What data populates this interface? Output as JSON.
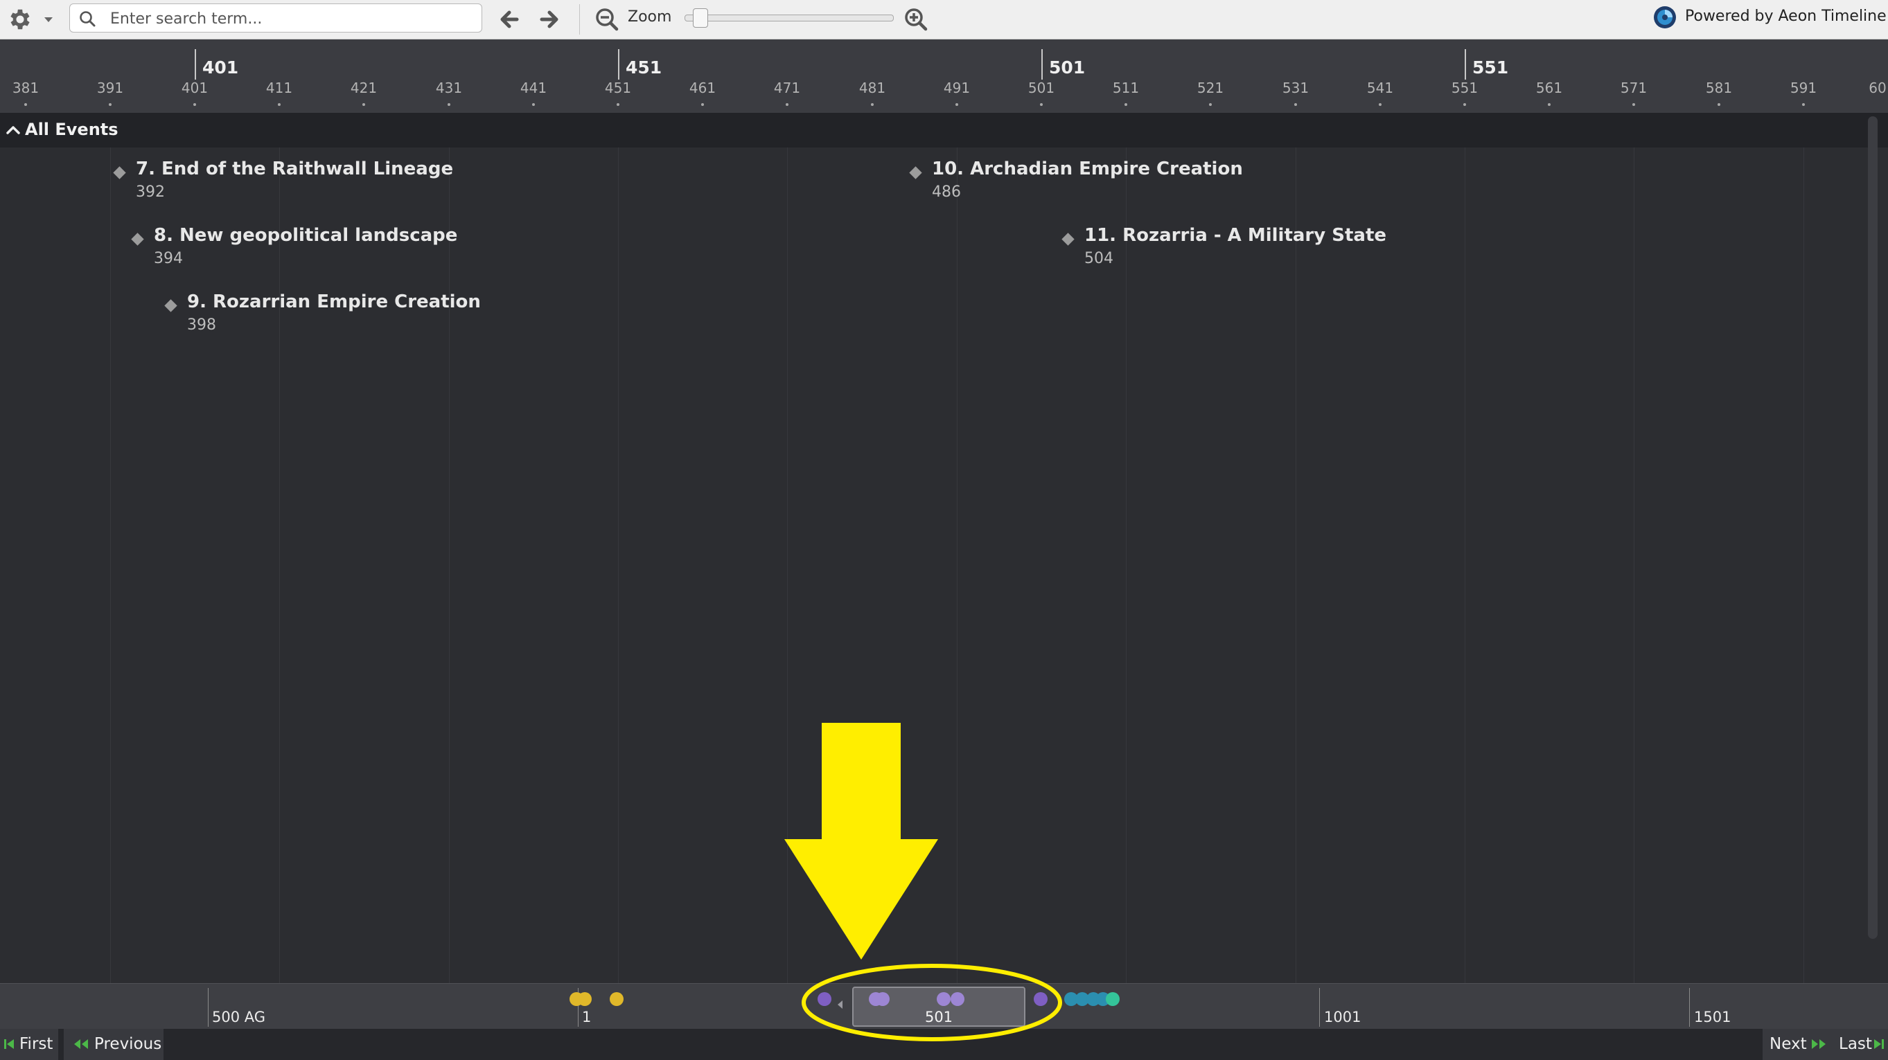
{
  "toolbar": {
    "settings_icon": "gear-icon",
    "search": {
      "placeholder": "Enter search term...",
      "value": ""
    },
    "back_icon": "arrow-left-icon",
    "forward_icon": "arrow-right-icon",
    "zoom_label": "Zoom",
    "zoom_level": 0.04,
    "powered_by": "Powered by Aeon Timeline"
  },
  "ruler": {
    "major_labels": [
      "401",
      "451",
      "501",
      "551"
    ],
    "minor_labels": [
      "381",
      "391",
      "401",
      "411",
      "421",
      "431",
      "441",
      "451",
      "461",
      "471",
      "481",
      "491",
      "501",
      "511",
      "521",
      "531",
      "541",
      "551",
      "561",
      "571",
      "581",
      "591",
      "60"
    ]
  },
  "group": {
    "label": "All Events"
  },
  "events": [
    {
      "title": "7. End of the Raithwall Lineage",
      "year": "392"
    },
    {
      "title": "8. New geopolitical landscape",
      "year": "394"
    },
    {
      "title": "9. Rozarrian Empire Creation",
      "year": "398"
    },
    {
      "title": "10. Archadian Empire Creation",
      "year": "486"
    },
    {
      "title": "11. Rozarria - A Military State",
      "year": "504"
    }
  ],
  "overview": {
    "labels": [
      "500 AG",
      "1",
      "501",
      "1001",
      "1501"
    ],
    "viewport_label": "501",
    "dot_colors": {
      "gold": "#e0b82a",
      "purple": "#7f5fc3",
      "lavender": "#9d86d4",
      "teal": "#2b8fb0",
      "green": "#34c49a"
    }
  },
  "nav": {
    "first": "First",
    "previous": "Previous",
    "next": "Next",
    "last": "Last"
  },
  "annotation": {
    "color": "#ffee00"
  }
}
